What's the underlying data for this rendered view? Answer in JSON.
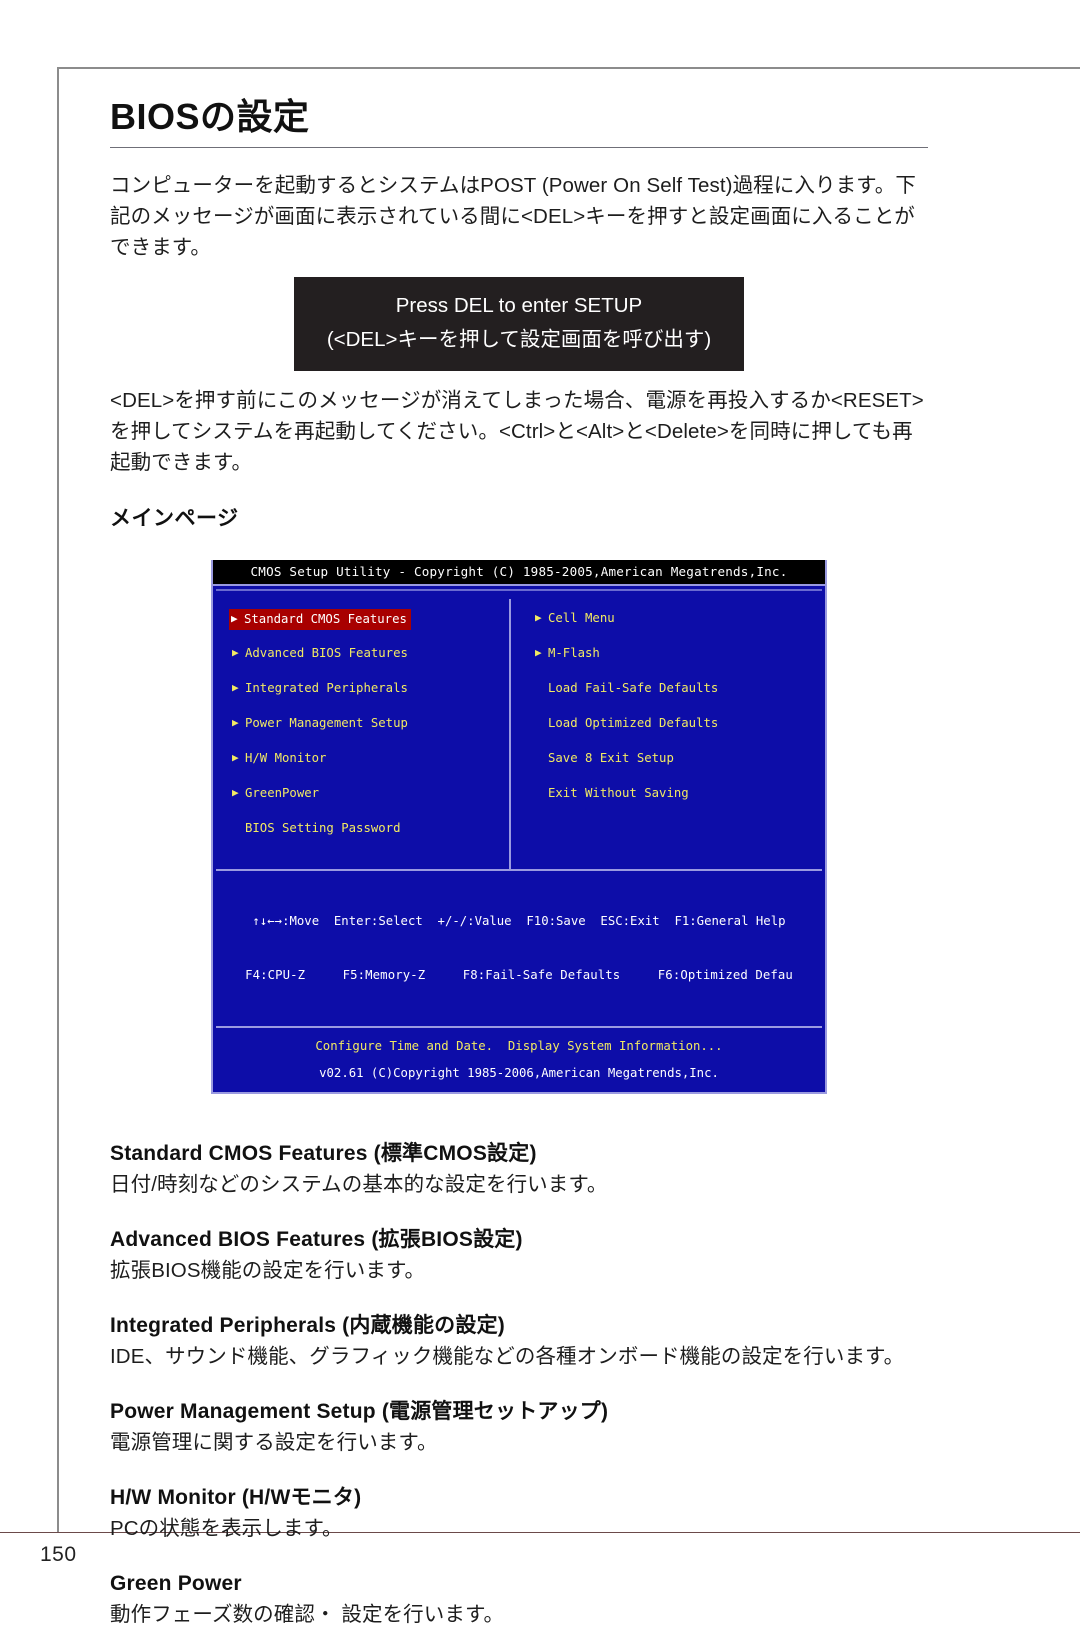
{
  "page": {
    "number": "150",
    "title": "BIOSの設定"
  },
  "intro": {
    "paragraph1": "コンピューターを起動するとシステムはPOST (Power On Self Test)過程に入ります。下記のメッセージが画面に表示されている間に<DEL>キーを押すと設定画面に入ることができます。",
    "post_box": {
      "line1": "Press DEL to enter SETUP",
      "line2": "(<DEL>キーを押して設定画面を呼び出す)"
    },
    "paragraph2": "<DEL>を押す前にこのメッセージが消えてしまった場合、電源を再投入するか<RESET>を押してシステムを再起動してください。<Ctrl>と<Alt>と<Delete>を同時に押しても再起動できます。",
    "section_heading": "メインページ"
  },
  "bios": {
    "titlebar": "CMOS Setup Utility - Copyright (C) 1985-2005,American Megatrends,Inc.",
    "left_items": [
      {
        "label": "Standard CMOS Features",
        "arrow": true,
        "selected": true
      },
      {
        "label": "Advanced BIOS Features",
        "arrow": true,
        "selected": false
      },
      {
        "label": "Integrated Peripherals",
        "arrow": true,
        "selected": false
      },
      {
        "label": "Power Management Setup",
        "arrow": true,
        "selected": false
      },
      {
        "label": "H/W Monitor",
        "arrow": true,
        "selected": false
      },
      {
        "label": "GreenPower",
        "arrow": true,
        "selected": false
      },
      {
        "label": "BIOS Setting Password",
        "arrow": false,
        "selected": false
      }
    ],
    "right_items": [
      {
        "label": "Cell Menu",
        "arrow": true,
        "selected": false
      },
      {
        "label": "M-Flash",
        "arrow": true,
        "selected": false
      },
      {
        "label": "Load Fail-Safe Defaults",
        "arrow": false,
        "selected": false
      },
      {
        "label": "Load Optimized Defaults",
        "arrow": false,
        "selected": false
      },
      {
        "label": "Save 8 Exit Setup",
        "arrow": false,
        "selected": false
      },
      {
        "label": "Exit Without Saving",
        "arrow": false,
        "selected": false
      }
    ],
    "keybar_line1": "↑↓←→:Move  Enter:Select  +/-/:Value  F10:Save  ESC:Exit  F1:General Help",
    "keybar_line2": "F4:CPU-Z     F5:Memory-Z     F8:Fail-Safe Defaults     F6:Optimized Defau",
    "hint": "Configure Time and Date.  Display System Information...",
    "version": "v02.61 (C)Copyright 1985-2006,American Megatrends,Inc.",
    "colors": {
      "background": "#0d0da8",
      "titlebar_bg": "#000000",
      "text": "#f2ea63",
      "selected_bg": "#a80000",
      "border": "#9a9ae0"
    }
  },
  "descriptions": [
    {
      "title": "Standard CMOS Features (標準CMOS設定)",
      "text": "日付/時刻などのシステムの基本的な設定を行います。"
    },
    {
      "title": "Advanced BIOS Features (拡張BIOS設定)",
      "text": "拡張BIOS機能の設定を行います。"
    },
    {
      "title": "Integrated Peripherals (内蔵機能の設定)",
      "text": "IDE、サウンド機能、グラフィック機能などの各種オンボード機能の設定を行います。"
    },
    {
      "title": "Power Management Setup (電源管理セットアップ)",
      "text": "電源管理に関する設定を行います。"
    },
    {
      "title": "H/W Monitor (H/Wモニタ)",
      "text": "PCの状態を表示します。"
    },
    {
      "title": "Green Power",
      "text": "動作フェーズ数の確認・ 設定を行います。"
    }
  ]
}
